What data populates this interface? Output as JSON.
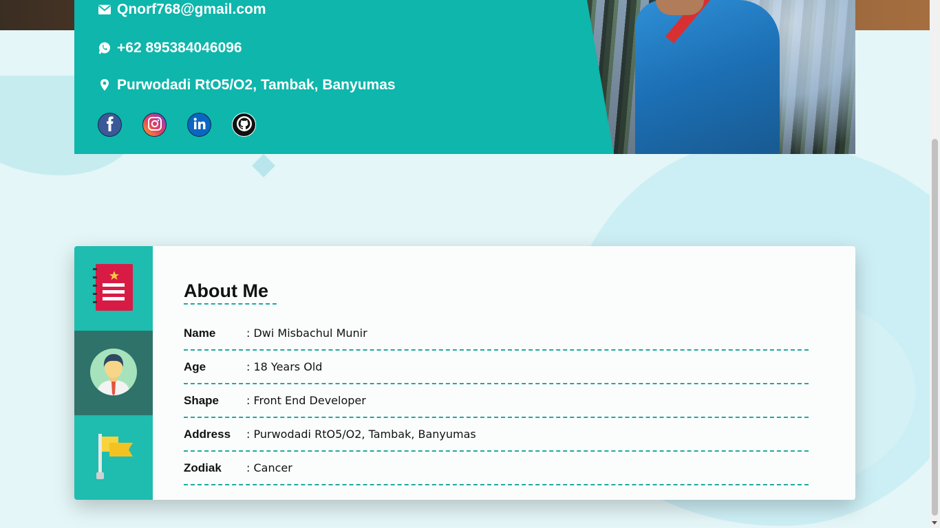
{
  "contact": {
    "email": "Qnorf768@gmail.com",
    "phone": "+62 895384046096",
    "address": "Purwodadi RtO5/O2, Tambak, Banyumas",
    "icons": {
      "email": "envelope-icon",
      "phone": "whatsapp-icon",
      "address": "location-pin-icon"
    },
    "socials": [
      {
        "name": "facebook",
        "icon": "facebook-icon"
      },
      {
        "name": "instagram",
        "icon": "instagram-icon"
      },
      {
        "name": "linkedin",
        "icon": "linkedin-icon"
      },
      {
        "name": "github",
        "icon": "github-icon"
      }
    ]
  },
  "about": {
    "title": "About Me",
    "rows": [
      {
        "label": "Name",
        "value": ": Dwi Misbachul Munir"
      },
      {
        "label": "Age",
        "value": ": 18 Years Old"
      },
      {
        "label": "Shape",
        "value": ": Front End Developer"
      },
      {
        "label": "Address",
        "value": ": Purwodadi RtO5/O2, Tambak, Banyumas"
      },
      {
        "label": "Zodiak",
        "value": ": Cancer"
      }
    ],
    "side_icons": [
      "notebook-icon",
      "user-avatar-icon",
      "flag-icon"
    ]
  },
  "colors": {
    "teal": "#0eb6ab",
    "teal_side": "#1fbcb0",
    "teal_dark": "#2e726a",
    "page_bg": "#e4f6f7"
  }
}
